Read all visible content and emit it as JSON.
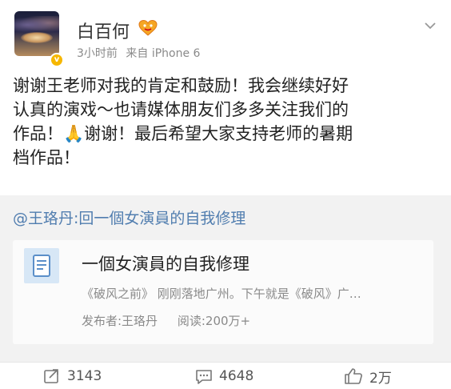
{
  "post": {
    "username": "白百何",
    "time": "3小时前",
    "source": "来自 iPhone 6",
    "verified_symbol": "v",
    "body_lines": [
      "谢谢王老师对我的肯定和鼓励！我会继续好好",
      "认真的演戏～也请媒体朋友们多多关注我们的",
      "作品！🙏谢谢！最后希望大家支持老师的暑期",
      "档作品！"
    ]
  },
  "repost": {
    "source_text": "@王珞丹:回一個女演員的自我修理",
    "card": {
      "title": "一個女演員的自我修理",
      "description": "《破风之前》 刚刚落地广州。下午就是《破风》广…",
      "publisher": "发布者:王珞丹",
      "reads": "阅读:200万+"
    }
  },
  "actions": {
    "repost_count": "3143",
    "comment_count": "4648",
    "like_count": "2万"
  },
  "icons": {
    "chevron": "chevron-down-icon",
    "vip": "vip-heart-icon",
    "article": "article-icon",
    "repost": "repost-icon",
    "comment": "comment-icon",
    "like": "thumbs-up-icon"
  },
  "colors": {
    "link": "#507daf",
    "verified": "#f6b700",
    "repost_bg": "#f2f2f2",
    "meta_text": "#8a8a8a"
  }
}
